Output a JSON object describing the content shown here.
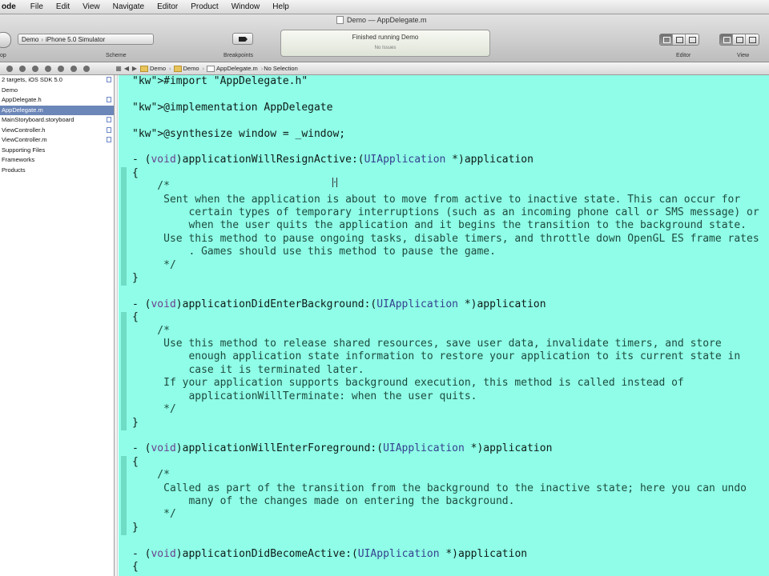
{
  "menubar": {
    "app": "ode",
    "items": [
      "File",
      "Edit",
      "View",
      "Navigate",
      "Editor",
      "Product",
      "Window",
      "Help"
    ]
  },
  "window": {
    "title": "Demo — AppDelegate.m"
  },
  "toolbar": {
    "scheme_project": "Demo",
    "scheme_destination": "iPhone 5.0 Simulator",
    "scheme_label": "Scheme",
    "breakpoints_label": "Breakpoints",
    "status_text": "Finished running Demo",
    "issues_text": "No Issues",
    "editor_label": "Editor",
    "view_label": "View",
    "left_label": "op"
  },
  "navigator": {
    "items": [
      {
        "label": "2 targets, iOS SDK 5.0",
        "modified": true,
        "selected": false
      },
      {
        "label": "Demo",
        "modified": false,
        "selected": false
      },
      {
        "label": "AppDelegate.h",
        "modified": true,
        "selected": false
      },
      {
        "label": "AppDelegate.m",
        "modified": false,
        "selected": true
      },
      {
        "label": "MainStoryboard.storyboard",
        "modified": true,
        "selected": false
      },
      {
        "label": "ViewController.h",
        "modified": true,
        "selected": false
      },
      {
        "label": "ViewController.m",
        "modified": true,
        "selected": false
      },
      {
        "label": "Supporting Files",
        "modified": false,
        "selected": false
      },
      {
        "label": "Frameworks",
        "modified": false,
        "selected": false
      },
      {
        "label": "Products",
        "modified": false,
        "selected": false
      }
    ]
  },
  "jumpbar": {
    "crumbs": [
      "Demo",
      "Demo",
      "AppDelegate.m"
    ],
    "selection": "No Selection"
  },
  "editor": {
    "lines": [
      "#import \"AppDelegate.h\"",
      "",
      "@implementation AppDelegate",
      "",
      "@synthesize window = _window;",
      "",
      "- (void)applicationWillResignActive:(UIApplication *)application",
      "{",
      "    /*",
      "     Sent when the application is about to move from active to inactive state. This can occur for",
      "         certain types of temporary interruptions (such as an incoming phone call or SMS message) or",
      "         when the user quits the application and it begins the transition to the background state.",
      "     Use this method to pause ongoing tasks, disable timers, and throttle down OpenGL ES frame rates",
      "         . Games should use this method to pause the game.",
      "     */",
      "}",
      "",
      "- (void)applicationDidEnterBackground:(UIApplication *)application",
      "{",
      "    /*",
      "     Use this method to release shared resources, save user data, invalidate timers, and store",
      "         enough application state information to restore your application to its current state in",
      "         case it is terminated later.",
      "     If your application supports background execution, this method is called instead of",
      "         applicationWillTerminate: when the user quits.",
      "     */",
      "}",
      "",
      "- (void)applicationWillEnterForeground:(UIApplication *)application",
      "{",
      "    /*",
      "     Called as part of the transition from the background to the inactive state; here you can undo",
      "         many of the changes made on entering the background.",
      "     */",
      "}",
      "",
      "- (void)applicationDidBecomeActive:(UIApplication *)application",
      "{"
    ]
  }
}
